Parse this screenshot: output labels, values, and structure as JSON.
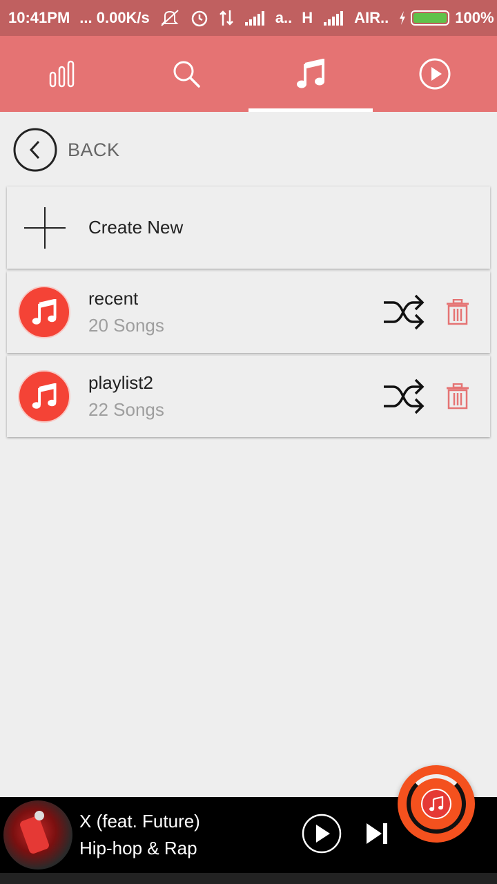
{
  "status_bar": {
    "time": "10:41PM",
    "net_speed": "... 0.00K/s",
    "carrier1": "a..",
    "net_type": "H",
    "carrier2": "AIR..",
    "battery": "100%"
  },
  "tabs": [
    {
      "icon": "equalizer-icon",
      "active": false
    },
    {
      "icon": "search-icon",
      "active": false
    },
    {
      "icon": "music-note-icon",
      "active": true
    },
    {
      "icon": "play-circle-icon",
      "active": false
    }
  ],
  "back": {
    "label": "BACK"
  },
  "create": {
    "label": "Create New"
  },
  "playlists": [
    {
      "name": "recent",
      "count": "20 Songs"
    },
    {
      "name": "playlist2",
      "count": "22 Songs"
    }
  ],
  "player": {
    "title": "X (feat. Future)",
    "artist": "Hip-hop & Rap"
  },
  "colors": {
    "accent": "#e57373",
    "status_bar": "#c06060",
    "playlist_icon": "#f44336",
    "delete": "#e57373",
    "fab": "#f4511e"
  }
}
